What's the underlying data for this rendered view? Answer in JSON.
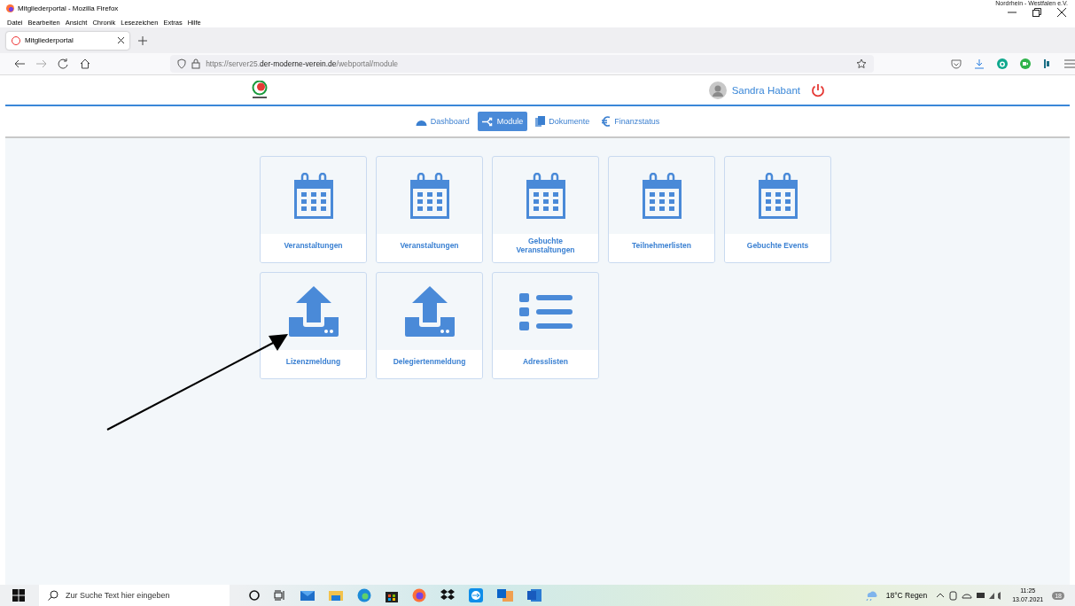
{
  "window": {
    "title": "Mitgliederportal - Mozilla Firefox",
    "corner_text": "Nordrhein - Westfalen e.V."
  },
  "menu": [
    "Datei",
    "Bearbeiten",
    "Ansicht",
    "Chronik",
    "Lesezeichen",
    "Extras",
    "Hilfe"
  ],
  "tabs": [
    {
      "label": "Mitgliederportal",
      "selected": true
    }
  ],
  "address": {
    "prefix": "https://server25.",
    "domain": "der-moderne-verein.de",
    "path": "/webportal/module"
  },
  "user": {
    "name": "Sandra Habant"
  },
  "nav": [
    {
      "label": "Dashboard",
      "kind": "gauge",
      "selected": false
    },
    {
      "label": "Module",
      "kind": "split",
      "selected": true
    },
    {
      "label": "Dokumente",
      "kind": "docs",
      "selected": false
    },
    {
      "label": "Finanzstatus",
      "kind": "euro",
      "selected": false
    }
  ],
  "modules": [
    {
      "label": "Veranstaltungen",
      "kind": "calendar"
    },
    {
      "label": "Veranstaltungen",
      "kind": "calendar"
    },
    {
      "label": "Gebuchte Veranstaltungen",
      "kind": "calendar"
    },
    {
      "label": "Teilnehmerlisten",
      "kind": "calendar"
    },
    {
      "label": "Gebuchte Events",
      "kind": "calendar"
    },
    {
      "label": "Lizenzmeldung",
      "kind": "upload"
    },
    {
      "label": "Delegiertenmeldung",
      "kind": "upload"
    },
    {
      "label": "Adresslisten",
      "kind": "list"
    }
  ],
  "taskbar": {
    "search_placeholder": "Zur Suche Text hier eingeben",
    "weather": "18°C  Regen",
    "time": "11:25",
    "date": "13.07.2021",
    "notifications": "18"
  }
}
